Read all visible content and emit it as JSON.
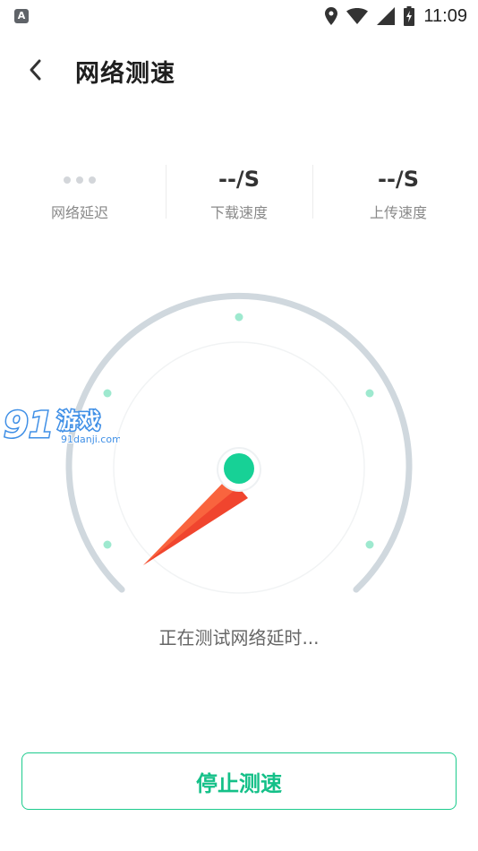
{
  "status_bar": {
    "app_icon_letter": "A",
    "time": "11:09"
  },
  "header": {
    "back_icon": "chevron-left-icon",
    "title": "网络测速"
  },
  "stats": [
    {
      "value": "",
      "label": "网络延迟",
      "placeholder_icon": "loading-dots-icon"
    },
    {
      "value": "--/S",
      "label": "下载速度"
    },
    {
      "value": "--/S",
      "label": "上传速度"
    }
  ],
  "gauge": {
    "needle_color": "#f0452e",
    "hub_color": "#17d196",
    "track_color": "#d0d8de",
    "tick_color": "#9ee9cf"
  },
  "watermark": {
    "brand": "91游戏",
    "domain": "91danji.com"
  },
  "status_text": "正在测试网络延时...",
  "stop_button": {
    "label": "停止测速",
    "color": "#14c088"
  }
}
